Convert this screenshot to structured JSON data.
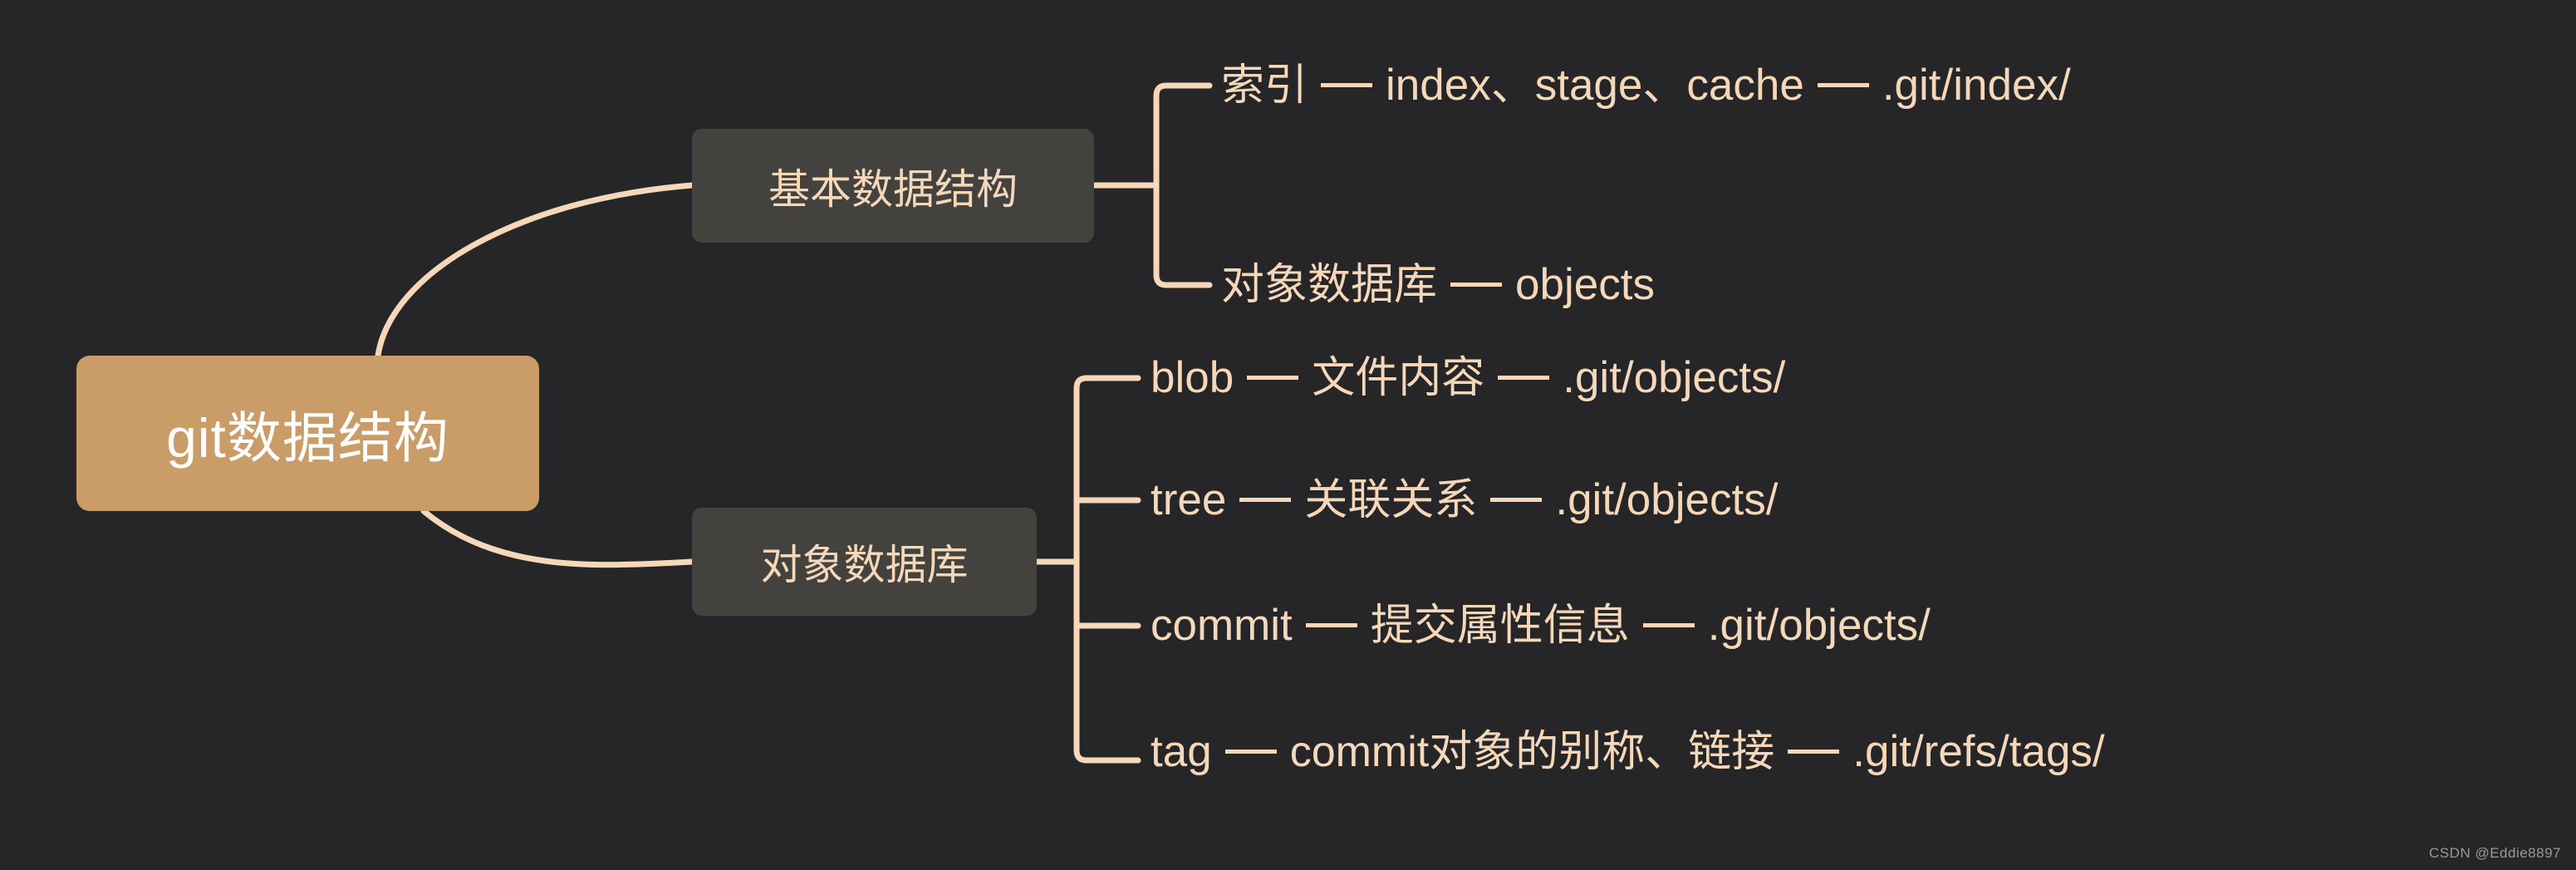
{
  "meta": {
    "background_color": "#262628",
    "root_color": "#CA9C67",
    "branch_color": "#43423E",
    "line_color": "#F5D7BA",
    "root_text_color": "#FFFFFF",
    "watermark": "CSDN @Eddie8897"
  },
  "mindmap": {
    "root": {
      "label": "git数据结构"
    },
    "branches": [
      {
        "label": "基本数据结构",
        "leaves": [
          {
            "name": "索引",
            "detail": "index、stage、cache",
            "path": ".git/index/"
          },
          {
            "name": "对象数据库",
            "detail": "objects",
            "path": ""
          }
        ]
      },
      {
        "label": "对象数据库",
        "leaves": [
          {
            "name": "blob",
            "detail": "文件内容",
            "path": ".git/objects/"
          },
          {
            "name": "tree",
            "detail": "关联关系",
            "path": ".git/objects/"
          },
          {
            "name": "commit",
            "detail": "提交属性信息",
            "path": ".git/objects/"
          },
          {
            "name": "tag",
            "detail": "commit对象的别称、链接",
            "path": ".git/refs/tags/"
          }
        ]
      }
    ]
  }
}
